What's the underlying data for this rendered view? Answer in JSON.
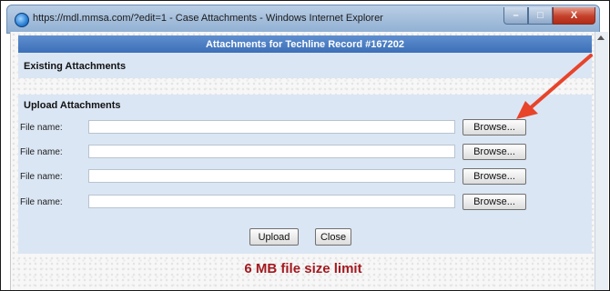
{
  "window": {
    "title": "https://mdl.mmsa.com/?edit=1 - Case Attachments - Windows Internet Explorer",
    "controls": {
      "minimize": "–",
      "maximize": "□",
      "close": "X"
    }
  },
  "page": {
    "header": "Attachments for Techline Record #167202",
    "existing_title": "Existing Attachments",
    "upload_title": "Upload Attachments",
    "file_rows": [
      {
        "label": "File name:",
        "value": "",
        "browse": "Browse..."
      },
      {
        "label": "File name:",
        "value": "",
        "browse": "Browse..."
      },
      {
        "label": "File name:",
        "value": "",
        "browse": "Browse..."
      },
      {
        "label": "File name:",
        "value": "",
        "browse": "Browse..."
      }
    ],
    "upload_button": "Upload",
    "close_button": "Close",
    "limit_note": "6 MB file size limit"
  },
  "colors": {
    "header_bar": "#4a7cc2",
    "section_bg": "#dbe6f4",
    "limit_text": "#a3191f",
    "annotation_arrow": "#e8442a"
  },
  "icons": [
    "ie-icon",
    "minimize-icon",
    "maximize-icon",
    "close-icon",
    "annotation-arrow-icon"
  ]
}
